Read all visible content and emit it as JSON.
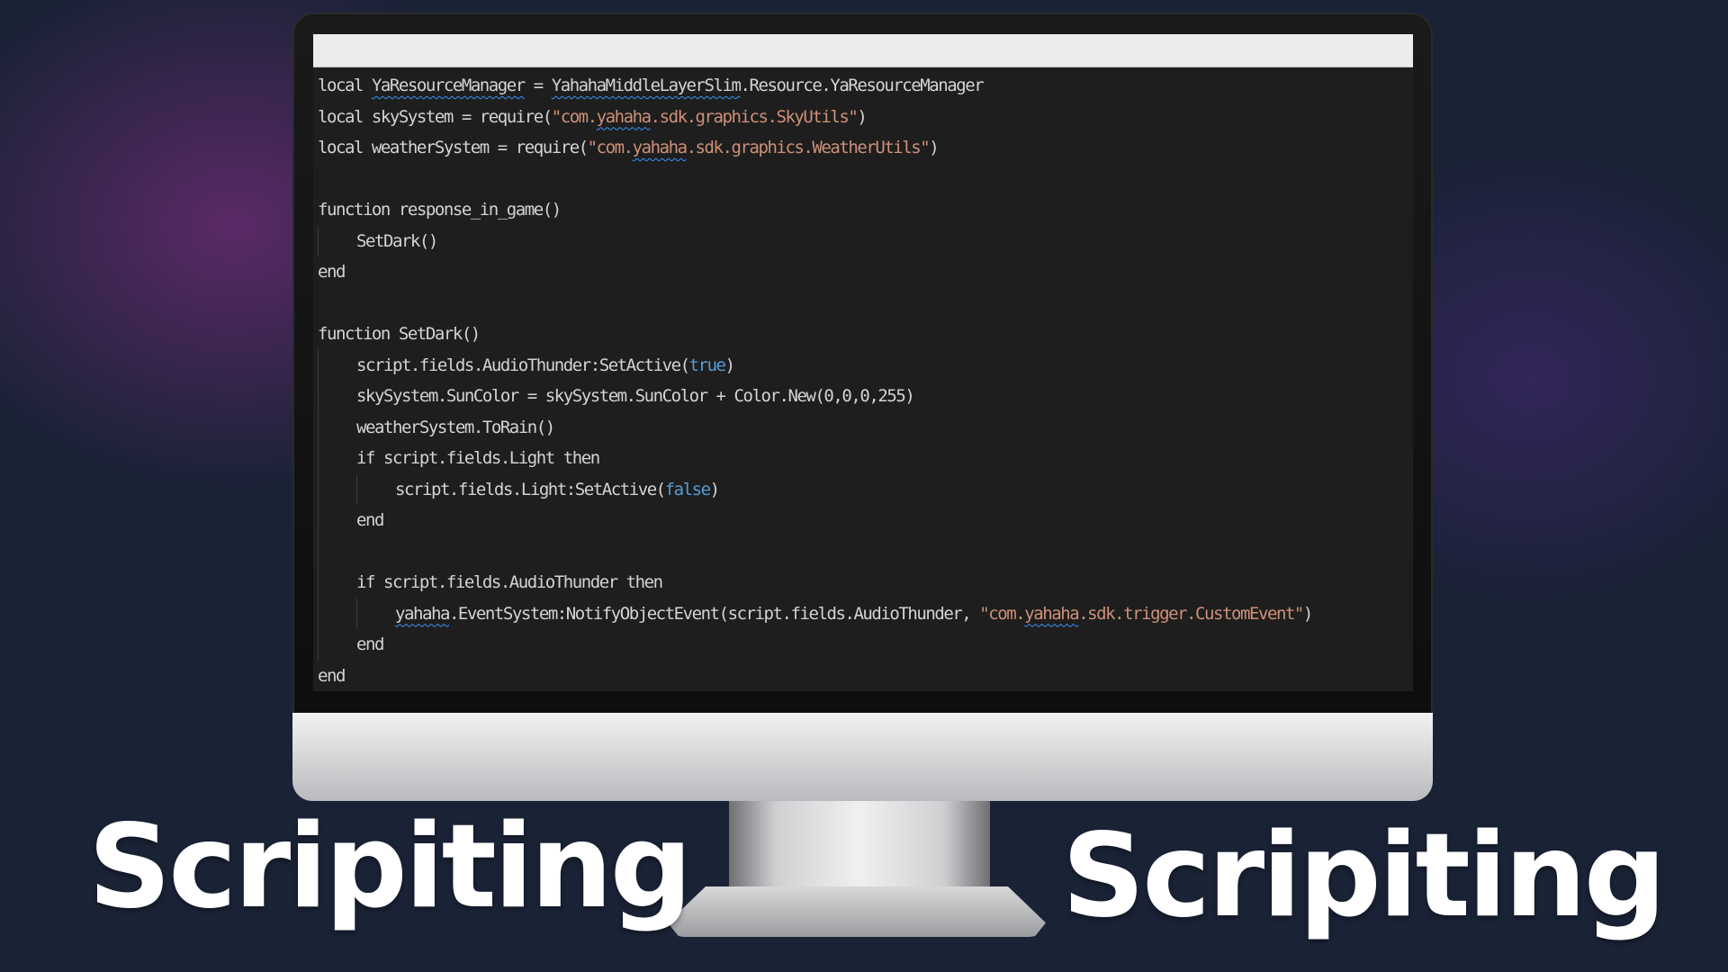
{
  "code_lines": [
    {
      "indent": 0,
      "parts": [
        {
          "t": "local "
        },
        {
          "t": "YaResourceManager",
          "s": "squiggle"
        },
        {
          "t": " = "
        },
        {
          "t": "YahahaMiddleLayerSlim",
          "s": "squiggle"
        },
        {
          "t": ".Resource.YaResourceManager"
        }
      ]
    },
    {
      "indent": 0,
      "parts": [
        {
          "t": "local skySystem = require("
        },
        {
          "t": "\"com.",
          "s": "str"
        },
        {
          "t": "yahaha",
          "s": "str-squiggle"
        },
        {
          "t": ".sdk.graphics.SkyUtils\"",
          "s": "str"
        },
        {
          "t": ")"
        }
      ]
    },
    {
      "indent": 0,
      "parts": [
        {
          "t": "local weatherSystem = require("
        },
        {
          "t": "\"com.",
          "s": "str"
        },
        {
          "t": "yahaha",
          "s": "str-squiggle"
        },
        {
          "t": ".sdk.graphics.WeatherUtils\"",
          "s": "str"
        },
        {
          "t": ")"
        }
      ]
    },
    {
      "indent": 0,
      "parts": []
    },
    {
      "indent": 0,
      "parts": [
        {
          "t": "function response_in_game()"
        }
      ]
    },
    {
      "indent": 1,
      "parts": [
        {
          "t": "SetDark()"
        }
      ]
    },
    {
      "indent": 0,
      "parts": [
        {
          "t": "end"
        }
      ]
    },
    {
      "indent": 0,
      "parts": []
    },
    {
      "indent": 0,
      "parts": [
        {
          "t": "function SetDark()"
        }
      ]
    },
    {
      "indent": 1,
      "parts": [
        {
          "t": "script.fields.AudioThunder:SetActive("
        },
        {
          "t": "true",
          "s": "bool"
        },
        {
          "t": ")"
        }
      ]
    },
    {
      "indent": 1,
      "parts": [
        {
          "t": "skySystem.SunColor = skySystem.SunColor + Color.New(0,0,0,255)"
        }
      ]
    },
    {
      "indent": 1,
      "parts": [
        {
          "t": "weatherSystem.ToRain()"
        }
      ]
    },
    {
      "indent": 1,
      "parts": [
        {
          "t": "if script.fields.Light then"
        }
      ]
    },
    {
      "indent": 2,
      "parts": [
        {
          "t": "script.fields.Light:SetActive("
        },
        {
          "t": "false",
          "s": "bool"
        },
        {
          "t": ")"
        }
      ]
    },
    {
      "indent": 1,
      "parts": [
        {
          "t": "end"
        }
      ]
    },
    {
      "indent": 1,
      "parts": []
    },
    {
      "indent": 1,
      "parts": [
        {
          "t": "if script.fields.AudioThunder then"
        }
      ]
    },
    {
      "indent": 2,
      "parts": [
        {
          "t": "yahaha",
          "s": "squiggle"
        },
        {
          "t": ".EventSystem:NotifyObjectEvent(script.fields.AudioThunder, "
        },
        {
          "t": "\"com.",
          "s": "str"
        },
        {
          "t": "yahaha",
          "s": "str-squiggle"
        },
        {
          "t": ".sdk.trigger.CustomEvent\"",
          "s": "str"
        },
        {
          "t": ")"
        }
      ]
    },
    {
      "indent": 1,
      "parts": [
        {
          "t": "end"
        }
      ]
    },
    {
      "indent": 0,
      "parts": [
        {
          "t": "end"
        }
      ]
    }
  ],
  "labels": {
    "left": "Scripiting",
    "right": "Scripiting"
  },
  "colors": {
    "background": "#1a2236",
    "editor_background": "#1e1e1e",
    "string": "#ce9178",
    "keyword_literal": "#569cd6",
    "plain_text": "#d4d4d4"
  }
}
